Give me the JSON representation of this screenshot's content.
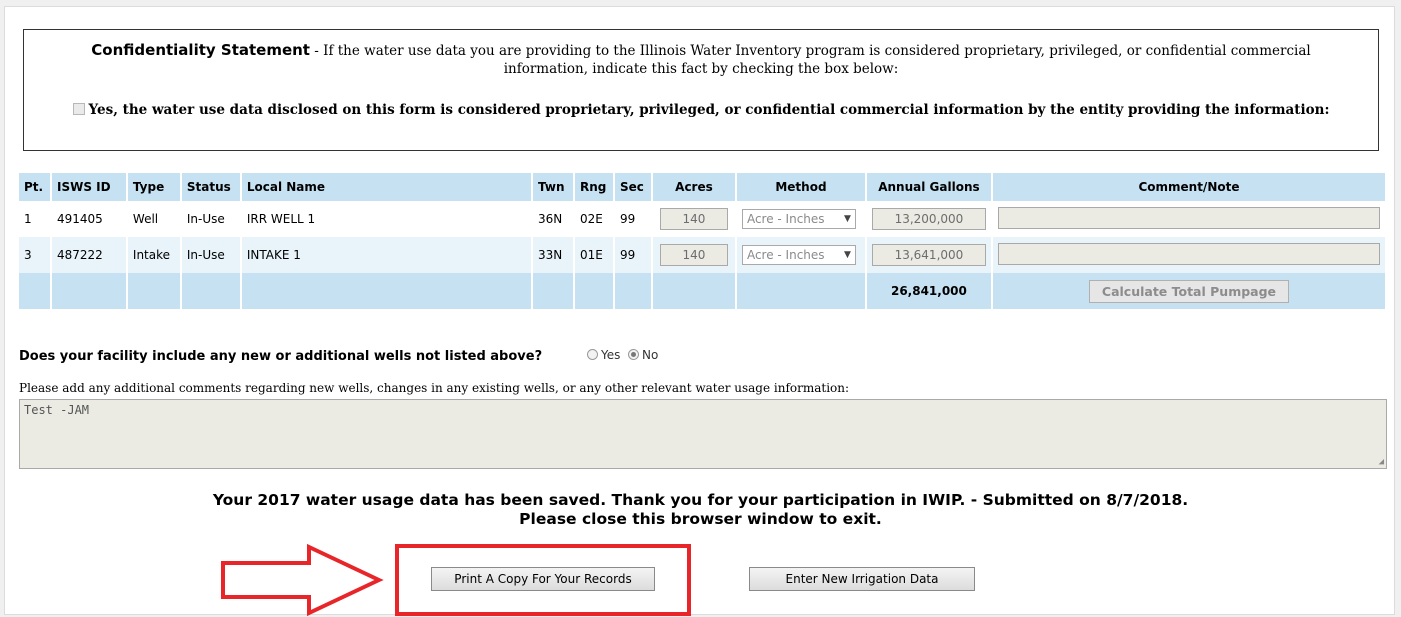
{
  "confidentiality": {
    "title": "Confidentiality Statement",
    "text": " - If the water use data you are providing to the Illinois Water Inventory program is considered proprietary, privileged, or confidential commercial information, indicate this fact by checking the box below:",
    "checkbox_label": "Yes, the water use data disclosed on this form is considered proprietary, privileged, or confidential commercial information by the entity providing the information:"
  },
  "table": {
    "headers": [
      "Pt.",
      "ISWS ID",
      "Type",
      "Status",
      "Local Name",
      "Twn",
      "Rng",
      "Sec",
      "Acres",
      "Method",
      "Annual Gallons",
      "Comment/Note"
    ],
    "rows": [
      {
        "pt": "1",
        "isws_id": "491405",
        "type": "Well",
        "status": "In-Use",
        "local_name": "IRR WELL 1",
        "twn": "36N",
        "rng": "02E",
        "sec": "99",
        "acres": "140",
        "method": "Acre - Inches",
        "gallons": "13,200,000",
        "comment": ""
      },
      {
        "pt": "3",
        "isws_id": "487222",
        "type": "Intake",
        "status": "In-Use",
        "local_name": "INTAKE 1",
        "twn": "33N",
        "rng": "01E",
        "sec": "99",
        "acres": "140",
        "method": "Acre - Inches",
        "gallons": "13,641,000",
        "comment": ""
      }
    ],
    "total_gallons": "26,841,000",
    "calc_button": "Calculate Total Pumpage"
  },
  "question": {
    "text": "Does your facility include any new or additional wells not listed above?",
    "yes_label": "Yes",
    "no_label": "No",
    "selected": "No"
  },
  "comments": {
    "label": "Please add any additional comments regarding new wells, changes in any existing wells, or any other relevant water usage information:",
    "value": "Test -JAM"
  },
  "saved_message": {
    "line1": "Your 2017 water usage data has been saved. Thank you for your participation in IWIP. - Submitted on 8/7/2018.",
    "line2": "Please close this browser window to exit."
  },
  "buttons": {
    "print": "Print A Copy For Your Records",
    "new_data": "Enter New Irrigation Data"
  },
  "colors": {
    "header_bg": "#c6e2f2",
    "row_alt_bg": "#e8f4fa",
    "highlight": "#e8262a"
  }
}
